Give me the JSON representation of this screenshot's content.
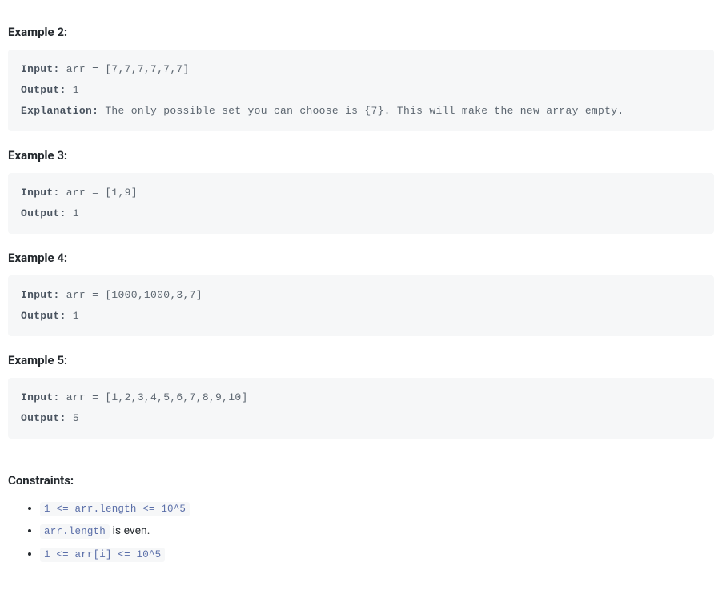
{
  "examples": [
    {
      "heading": "Example 2:",
      "input_label": "Input:",
      "input_value": " arr = [7,7,7,7,7,7]",
      "output_label": "Output:",
      "output_value": " 1",
      "explanation_label": "Explanation:",
      "explanation_value": " The only possible set you can choose is {7}. This will make the new array empty."
    },
    {
      "heading": "Example 3:",
      "input_label": "Input:",
      "input_value": " arr = [1,9]",
      "output_label": "Output:",
      "output_value": " 1"
    },
    {
      "heading": "Example 4:",
      "input_label": "Input:",
      "input_value": " arr = [1000,1000,3,7]",
      "output_label": "Output:",
      "output_value": " 1"
    },
    {
      "heading": "Example 5:",
      "input_label": "Input:",
      "input_value": " arr = [1,2,3,4,5,6,7,8,9,10]",
      "output_label": "Output:",
      "output_value": " 5"
    }
  ],
  "constraints": {
    "heading": "Constraints:",
    "items": [
      {
        "code": "1 <= arr.length <= 10^5",
        "tail": ""
      },
      {
        "code": "arr.length",
        "tail": " is even."
      },
      {
        "code": "1 <= arr[i] <= 10^5",
        "tail": ""
      }
    ]
  }
}
